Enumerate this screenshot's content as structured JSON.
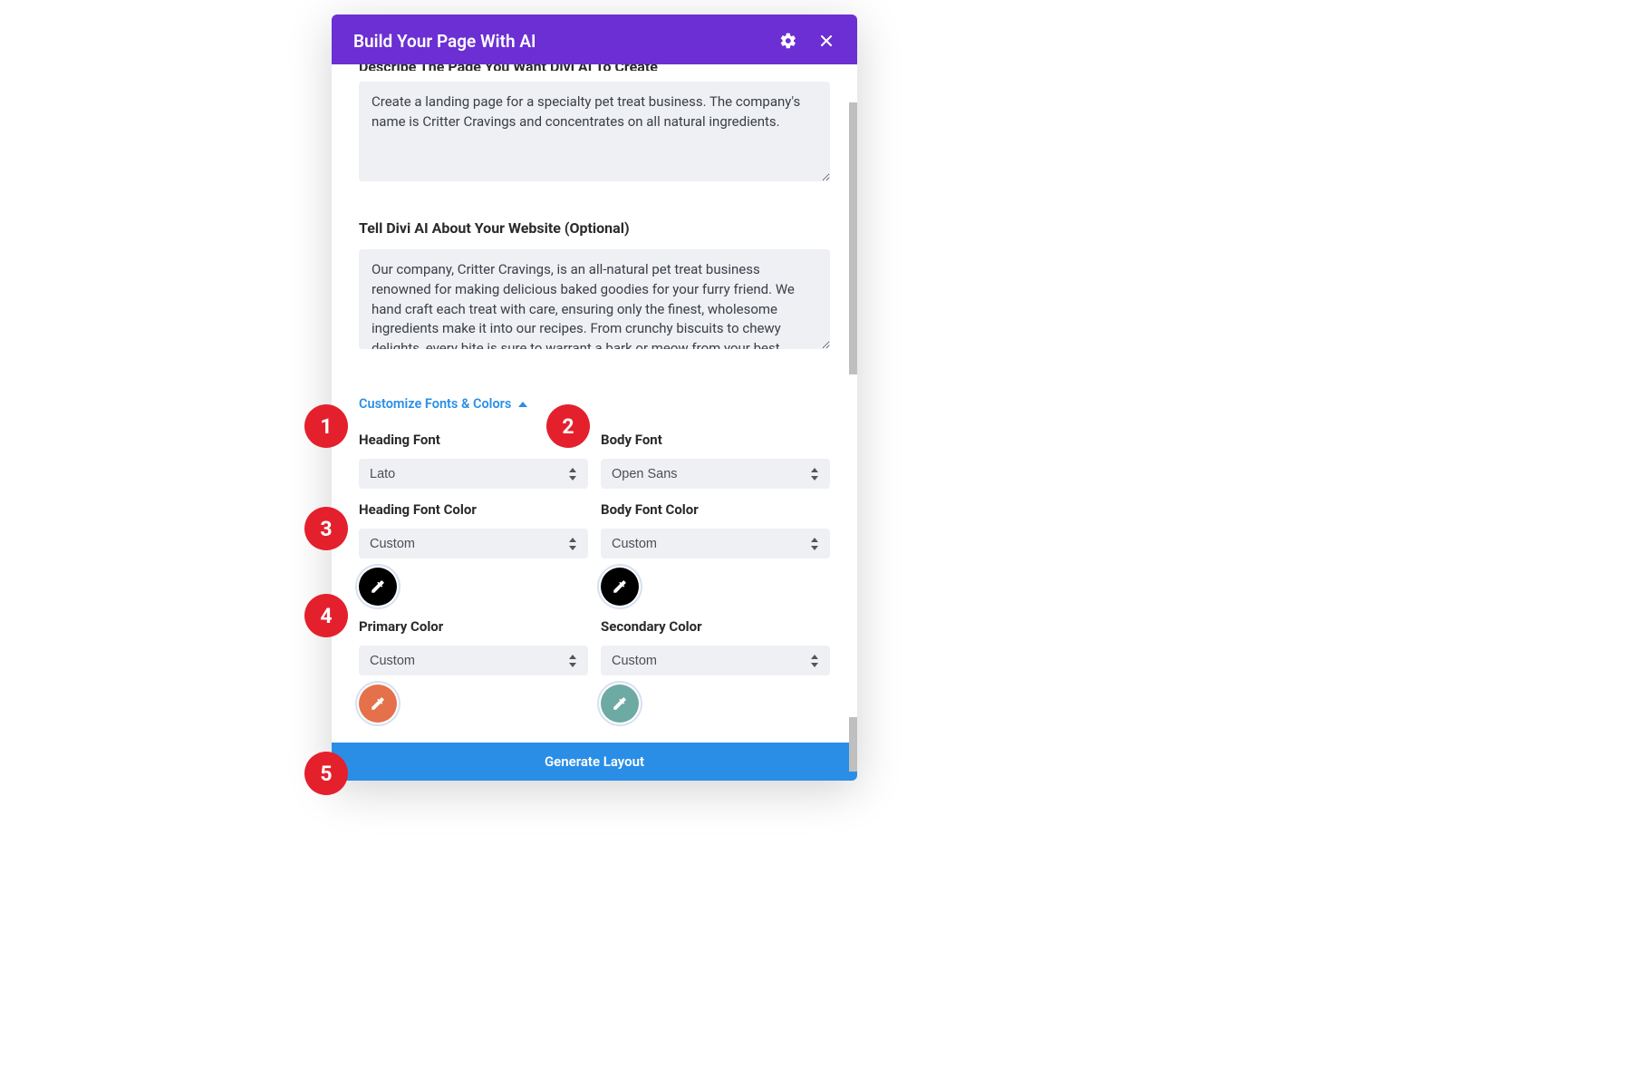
{
  "header": {
    "title": "Build Your Page With AI"
  },
  "labels": {
    "describe_cut": "Describe The Page You Want Divi AI To Create",
    "tell_about": "Tell Divi AI About Your Website (Optional)",
    "customize": "Customize Fonts & Colors",
    "heading_font": "Heading Font",
    "body_font": "Body Font",
    "heading_font_color": "Heading Font Color",
    "body_font_color": "Body Font Color",
    "primary_color": "Primary Color",
    "secondary_color": "Secondary Color",
    "generate": "Generate Layout"
  },
  "values": {
    "prompt1": "Create a landing page for a specialty pet treat business. The company's name is Critter Cravings and concentrates on all natural ingredients.",
    "prompt2": "Our company, Critter Cravings, is an all-natural pet treat business renowned for making delicious baked goodies for your furry friend. We hand craft each treat with care, ensuring only the finest, wholesome ingredients make it into our recipes. From crunchy biscuits to chewy delights, every bite is sure to warrant a bark or meow from your best friend.",
    "heading_font": "Lato",
    "body_font": "Open Sans",
    "heading_font_color": "Custom",
    "body_font_color": "Custom",
    "primary_color": "Custom",
    "secondary_color": "Custom"
  },
  "swatches": {
    "heading_font_color": "#000000",
    "body_font_color": "#000000",
    "primary_color": "#e5714a",
    "secondary_color": "#6eaaa4"
  },
  "badges": [
    "1",
    "2",
    "3",
    "4",
    "5"
  ]
}
